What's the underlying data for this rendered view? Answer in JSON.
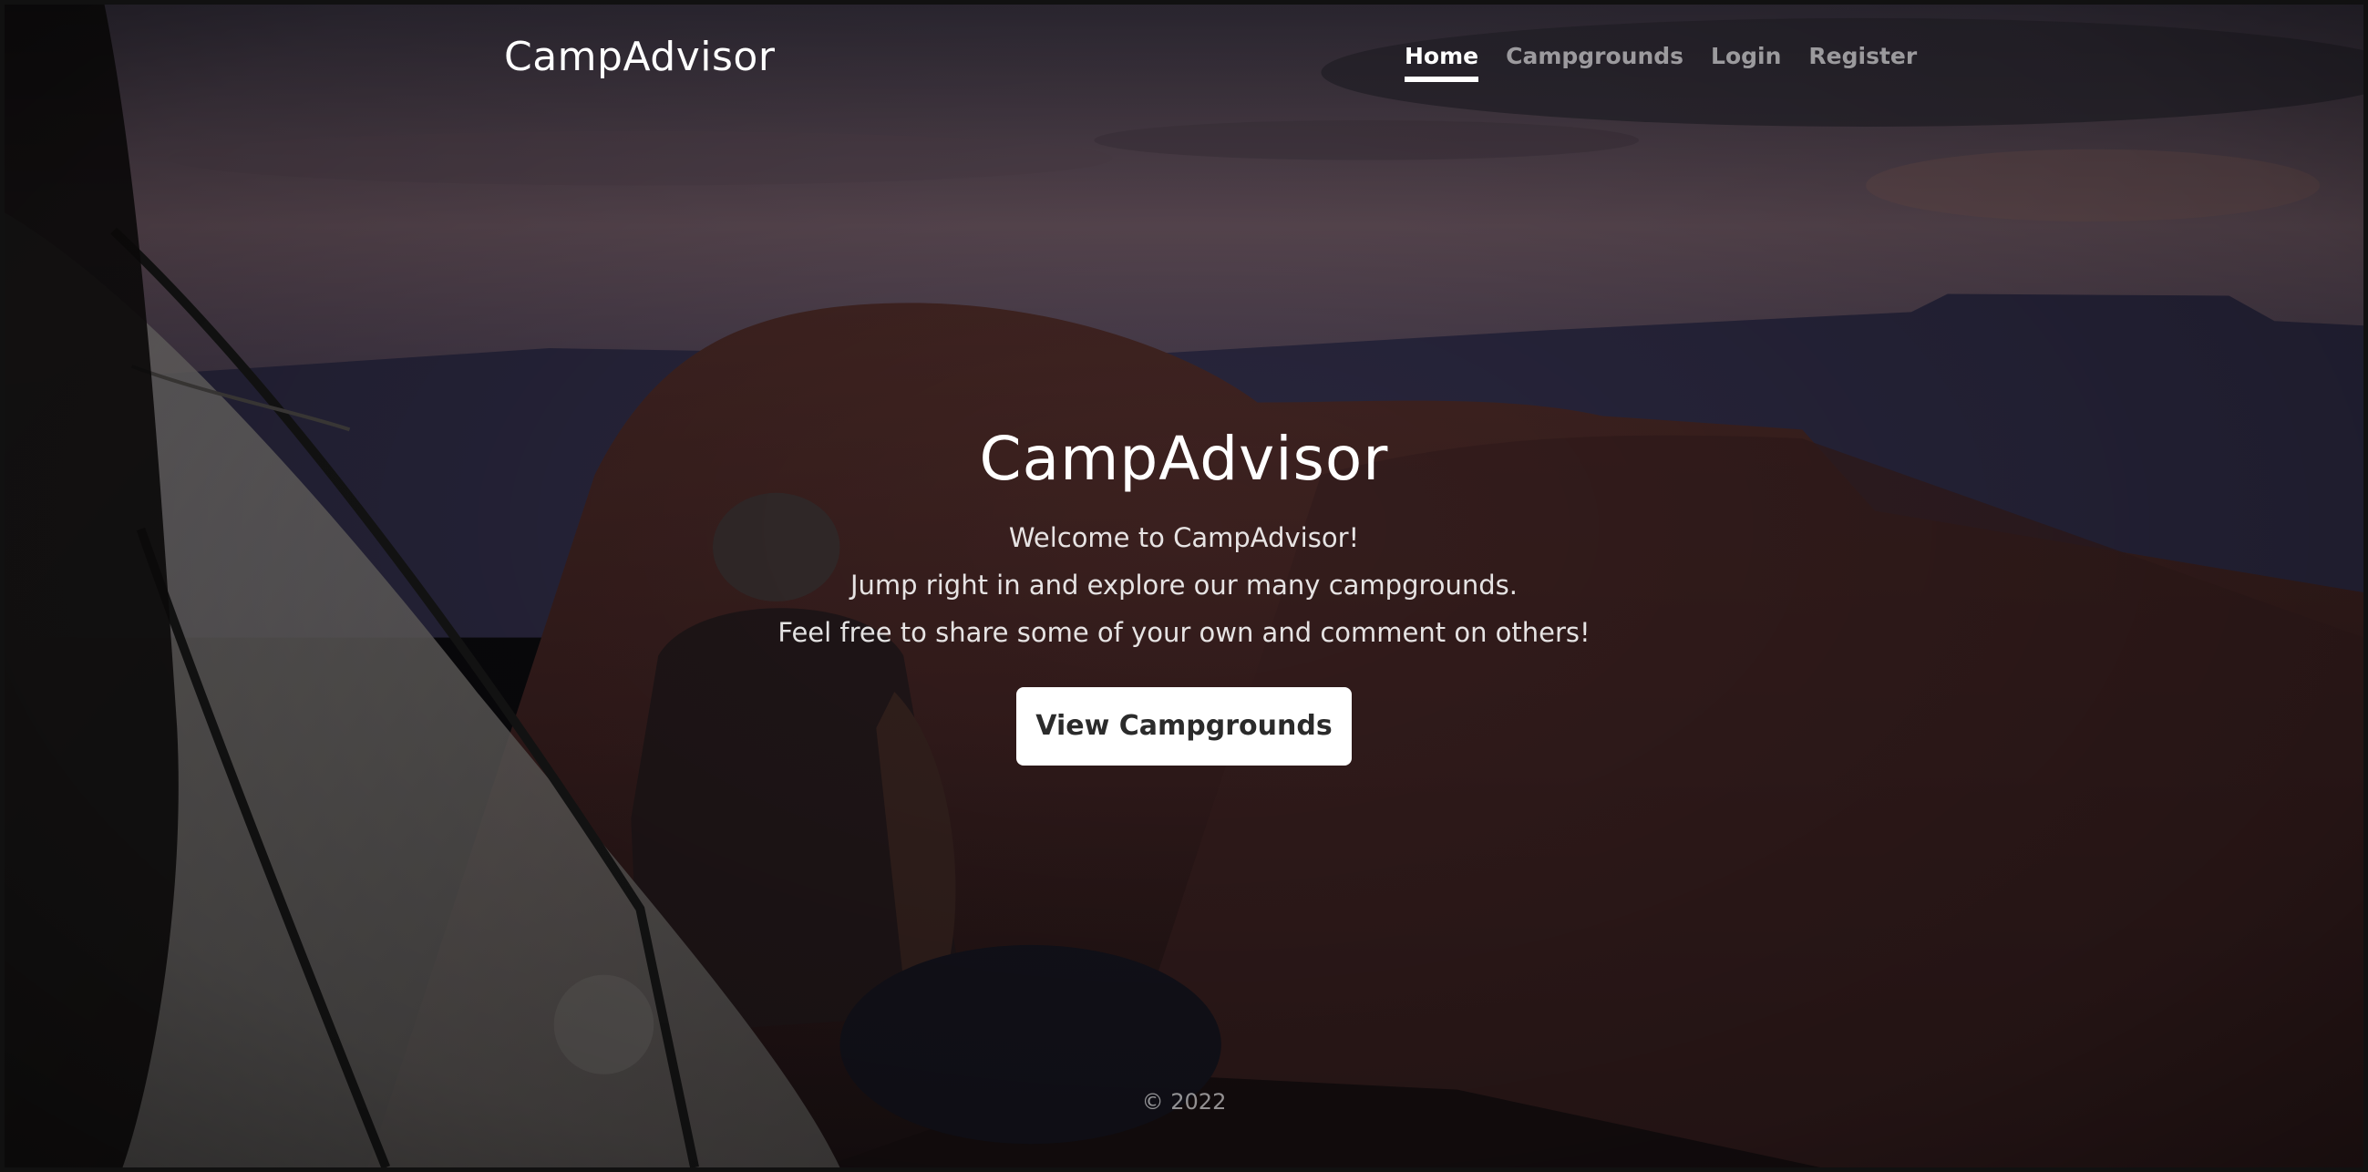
{
  "navbar": {
    "brand": "CampAdvisor",
    "links": [
      {
        "label": "Home",
        "active": true
      },
      {
        "label": "Campgrounds",
        "active": false
      },
      {
        "label": "Login",
        "active": false
      },
      {
        "label": "Register",
        "active": false
      }
    ]
  },
  "hero": {
    "title": "CampAdvisor",
    "lines": [
      "Welcome to CampAdvisor!",
      "Jump right in and explore our many campgrounds.",
      "Feel free to share some of your own and comment on others!"
    ],
    "button_label": "View Campgrounds"
  },
  "footer": {
    "text": "© 2022"
  },
  "colors": {
    "button_bg": "#ffffff",
    "text": "#ffffff",
    "muted_text": "#8c8c8c"
  }
}
